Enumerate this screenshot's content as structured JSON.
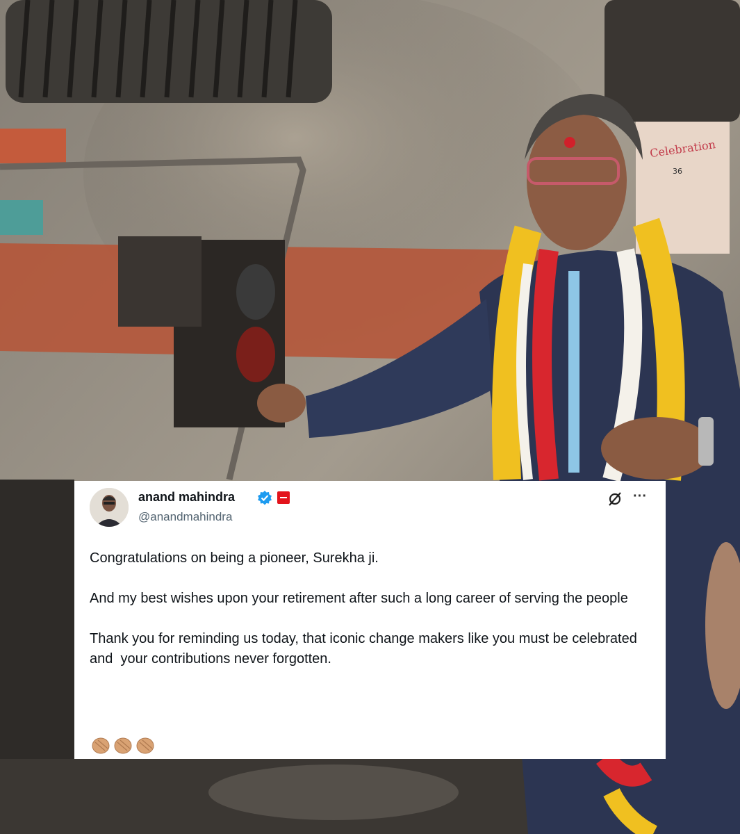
{
  "tweet": {
    "display_name": "anand mahindra",
    "handle": "@anandmahindra",
    "paragraphs": [
      "Congratulations on being a pioneer, Surekha ji.",
      "And my best wishes upon your retirement after such a long career of serving the people",
      "Thank you for reminding us today, that iconic change makers like you must be celebrated and  your contributions never forgotten."
    ],
    "emoji": "clapping-hands x3"
  },
  "background": {
    "banner_text": "Celebration",
    "banner_number": "36"
  },
  "colors": {
    "verified_blue": "#1d9bf0",
    "affiliation_red": "#e3141c",
    "handle_gray": "#536471",
    "text_black": "#0f1419",
    "locomotive_stripe": "#b5563a"
  },
  "icons": [
    "verified-badge-icon",
    "affiliation-badge-icon",
    "grok-icon",
    "more-options-icon",
    "clapping-hands-icon"
  ]
}
